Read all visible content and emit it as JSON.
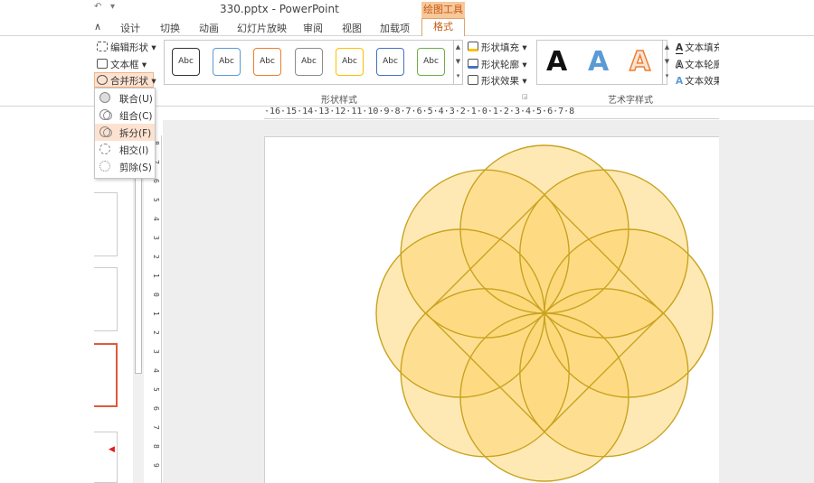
{
  "window": {
    "title": "330.pptx - PowerPoint",
    "context_tab_group": "绘图工具",
    "quick_access": [
      "↶",
      "▾"
    ]
  },
  "tabs": [
    "设计",
    "切换",
    "动画",
    "幻灯片放映",
    "审阅",
    "视图",
    "加载项",
    "格式"
  ],
  "ribbon": {
    "insert_shapes": {
      "edit_shape": "编辑形状 ▾",
      "text_box": "文本框 ▾",
      "merge_shapes": "合并形状 ▾"
    },
    "shape_styles": {
      "group_label": "形状样式",
      "preset_label": "Abc",
      "preset_colors": [
        "#333333",
        "#5b9bd5",
        "#ed7d31",
        "#8c8c8c",
        "#ffc000",
        "#4472c4",
        "#70ad47"
      ],
      "fill": "形状填充 ▾",
      "outline": "形状轮廓 ▾",
      "effects": "形状效果 ▾"
    },
    "wordart_styles": {
      "group_label": "艺术字样式",
      "samples": [
        {
          "letter": "A",
          "color": "#111111"
        },
        {
          "letter": "A",
          "color": "#5b9bd5"
        },
        {
          "letter": "A",
          "color": "#f4b183"
        }
      ],
      "text_fill": "文本填充",
      "text_outline": "文本轮廓",
      "text_effects": "文本效果"
    }
  },
  "merge_menu": {
    "items": [
      {
        "label": "联合(U)"
      },
      {
        "label": "组合(C)"
      },
      {
        "label": "拆分(F)"
      },
      {
        "label": "相交(I)"
      },
      {
        "label": "剪除(S)"
      }
    ],
    "active_index": 2
  },
  "rulers": {
    "horizontal": "·16·15·14·13·12·11·10·9·8·7·6·5·4·3·2·1·0·1·2·3·4·5·6·7·8",
    "vertical": [
      "8",
      "7",
      "6",
      "5",
      "4",
      "3",
      "2",
      "1",
      "0",
      "1",
      "2",
      "3",
      "4",
      "5",
      "6",
      "7",
      "8",
      "9"
    ]
  },
  "diagram": {
    "fill_color": "#fdd776",
    "stroke_color": "#c9a320",
    "circle_count": 8,
    "has_inner_square": true
  }
}
